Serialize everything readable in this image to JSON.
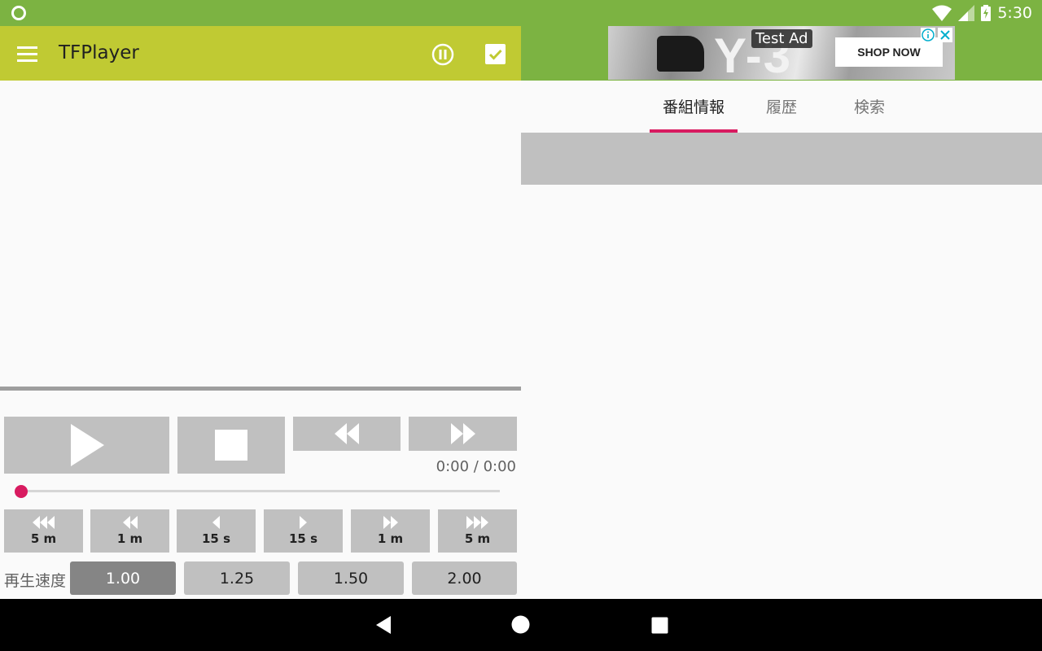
{
  "status_bar": {
    "time": "5:30",
    "background": "#7cb342"
  },
  "app_bar": {
    "title": "TFPlayer",
    "background": "#c0ca33",
    "icons": [
      "menu-icon",
      "pause-circle-icon",
      "check-box-icon"
    ]
  },
  "ad": {
    "label": "Test Ad",
    "brand": "Y-3",
    "cta": "SHOP NOW"
  },
  "tabs": [
    {
      "label": "番組情報",
      "selected": true
    },
    {
      "label": "履歴",
      "selected": false
    },
    {
      "label": "検索",
      "selected": false
    }
  ],
  "accent_color": "#d81b60",
  "player": {
    "time_display": "0:00 / 0:00",
    "seek_progress": 0,
    "skip_buttons": [
      {
        "label": "5 m",
        "icon": "triple-rewind-icon"
      },
      {
        "label": "1 m",
        "icon": "double-rewind-icon"
      },
      {
        "label": "15 s",
        "icon": "single-rewind-icon"
      },
      {
        "label": "15 s",
        "icon": "single-forward-icon"
      },
      {
        "label": "1 m",
        "icon": "double-forward-icon"
      },
      {
        "label": "5 m",
        "icon": "triple-forward-icon"
      }
    ],
    "speed_label": "再生速度",
    "speeds": [
      {
        "label": "1.00",
        "selected": true
      },
      {
        "label": "1.25",
        "selected": false
      },
      {
        "label": "1.50",
        "selected": false
      },
      {
        "label": "2.00",
        "selected": false
      }
    ]
  }
}
